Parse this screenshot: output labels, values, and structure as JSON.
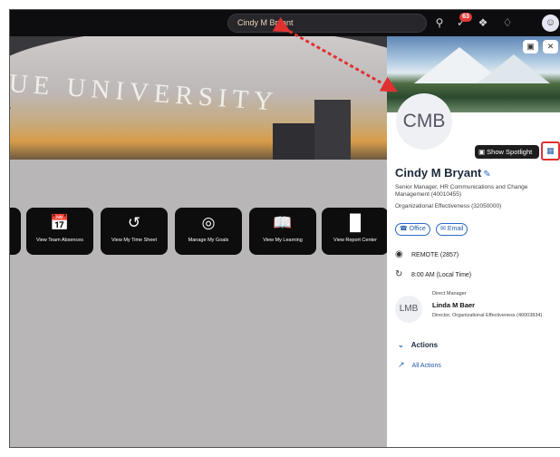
{
  "shell": {
    "search_value": "Cindy M Bryant",
    "notification_count": "63",
    "icons": [
      "search-icon",
      "approvals-icon",
      "copilot-icon",
      "bell-icon",
      "user-icon"
    ]
  },
  "hero": {
    "text": "UE UNIVERSITY"
  },
  "tiles": [
    {
      "icon": "calendar-icon",
      "label": "View Team Absences"
    },
    {
      "icon": "history-icon",
      "label": "View My Time Sheet"
    },
    {
      "icon": "target-icon",
      "label": "Manage My Goals"
    },
    {
      "icon": "book-icon",
      "label": "View My Learning"
    },
    {
      "icon": "chart-icon",
      "label": "View Report Center"
    }
  ],
  "profile": {
    "initials": "CMB",
    "spotlight_label": "Show Spotlight",
    "name": "Cindy M Bryant",
    "title": "Senior Manager, HR Communications and Change Management (40010455)",
    "department": "Organizational Effectiveness (32050000)",
    "office_label": "Office",
    "email_label": "Email",
    "location": "REMOTE (2857)",
    "local_time": "8:00 AM (Local Time)",
    "manager": {
      "caption": "Direct Manager",
      "initials": "LMB",
      "name": "Linda M Baer",
      "role": "Director, Organizational Effectiveness (40003834)"
    },
    "actions_heading": "Actions",
    "all_actions_label": "All Actions"
  },
  "colors": {
    "accent": "#2a69c7",
    "highlight": "#e03131",
    "shell": "#0d0d10",
    "badge": "#e23a3a"
  }
}
